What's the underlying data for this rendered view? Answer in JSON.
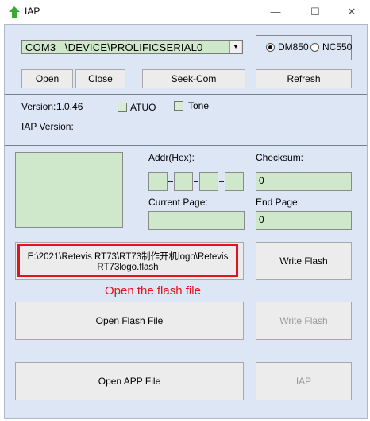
{
  "window": {
    "title": "IAP",
    "controls": {
      "minimize": "—",
      "maximize": "☐",
      "close": "✕"
    }
  },
  "port": {
    "combo_value": "COM3   \\DEVICE\\PROLIFICSERIAL0",
    "radio_options": [
      {
        "label": "DM850",
        "selected": true
      },
      {
        "label": "NC550",
        "selected": false
      }
    ],
    "buttons": {
      "open": "Open",
      "close": "Close",
      "seek": "Seek-Com",
      "refresh": "Refresh"
    }
  },
  "info": {
    "version_label": "Version:",
    "version_value": "1.0.46",
    "atuo_label": "ATUO",
    "atuo_checked": false,
    "tone_label": "Tone",
    "tone_checked": false,
    "iap_version_label": "IAP Version:"
  },
  "flash": {
    "addr_label": "Addr(Hex):",
    "checksum_label": "Checksum:",
    "checksum_value": "0",
    "current_page_label": "Current Page:",
    "current_page_value": "",
    "end_page_label": "End Page:",
    "end_page_value": "0",
    "file_path_line1": "E:\\2021\\Retevis RT73\\RT73制作开机logo\\Retevis",
    "file_path_line2": "RT73logo.flash",
    "hint": "Open the flash file",
    "write_flash": "Write Flash",
    "open_flash_file": "Open Flash File",
    "write_flash_disabled": "Write Flash",
    "open_app_file": "Open APP File",
    "iap": "IAP"
  },
  "colors": {
    "field_green": "#cfe8cc",
    "client_blue": "#dce6f5",
    "annotation_red": "#e0141e"
  }
}
